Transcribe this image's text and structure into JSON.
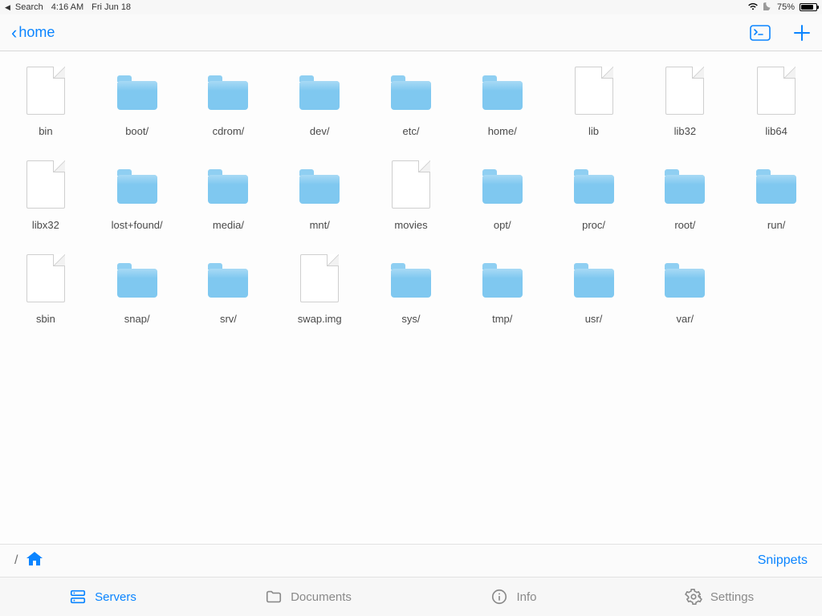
{
  "status": {
    "back_app": "Search",
    "time": "4:16 AM",
    "date": "Fri Jun 18",
    "battery_pct": "75%"
  },
  "nav": {
    "back_label": "home"
  },
  "items": [
    {
      "name": "bin",
      "type": "file"
    },
    {
      "name": "boot/",
      "type": "folder"
    },
    {
      "name": "cdrom/",
      "type": "folder"
    },
    {
      "name": "dev/",
      "type": "folder"
    },
    {
      "name": "etc/",
      "type": "folder"
    },
    {
      "name": "home/",
      "type": "folder"
    },
    {
      "name": "lib",
      "type": "file"
    },
    {
      "name": "lib32",
      "type": "file"
    },
    {
      "name": "lib64",
      "type": "file"
    },
    {
      "name": "libx32",
      "type": "file"
    },
    {
      "name": "lost+found/",
      "type": "folder"
    },
    {
      "name": "media/",
      "type": "folder"
    },
    {
      "name": "mnt/",
      "type": "folder"
    },
    {
      "name": "movies",
      "type": "file"
    },
    {
      "name": "opt/",
      "type": "folder"
    },
    {
      "name": "proc/",
      "type": "folder"
    },
    {
      "name": "root/",
      "type": "folder"
    },
    {
      "name": "run/",
      "type": "folder"
    },
    {
      "name": "sbin",
      "type": "file"
    },
    {
      "name": "snap/",
      "type": "folder"
    },
    {
      "name": "srv/",
      "type": "folder"
    },
    {
      "name": "swap.img",
      "type": "file"
    },
    {
      "name": "sys/",
      "type": "folder"
    },
    {
      "name": "tmp/",
      "type": "folder"
    },
    {
      "name": "usr/",
      "type": "folder"
    },
    {
      "name": "var/",
      "type": "folder"
    }
  ],
  "path": {
    "root": "/",
    "snippets_label": "Snippets"
  },
  "tabs": {
    "servers": "Servers",
    "documents": "Documents",
    "info": "Info",
    "settings": "Settings"
  }
}
